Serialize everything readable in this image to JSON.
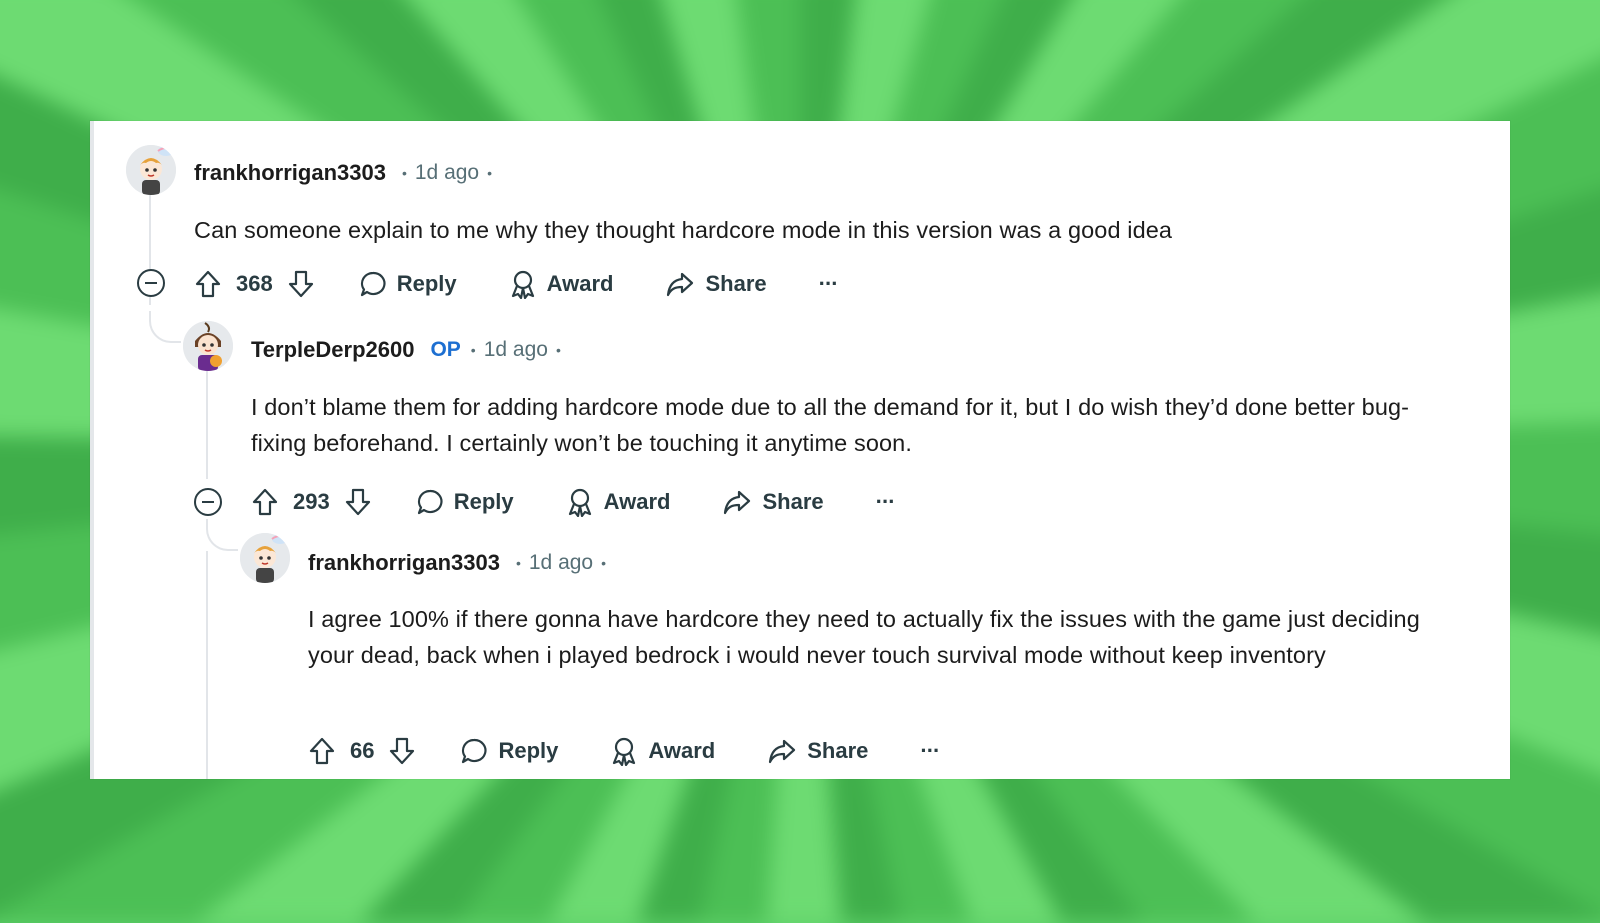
{
  "thread": {
    "comments": [
      {
        "username": "frankhorrigan3303",
        "op_badge": "",
        "time": "1d ago",
        "body": "Can someone explain to me why they thought hardcore mode in this version was a good idea",
        "score": "368",
        "reply_label": "Reply",
        "award_label": "Award",
        "share_label": "Share",
        "more_label": "···"
      },
      {
        "username": "TerpleDerp2600",
        "op_badge": "OP",
        "time": "1d ago",
        "body": "I don’t blame them for adding hardcore mode due to all the demand for it, but I do wish they’d done better bug-fixing beforehand. I certainly won’t be touching it anytime soon.",
        "score": "293",
        "reply_label": "Reply",
        "award_label": "Award",
        "share_label": "Share",
        "more_label": "···"
      },
      {
        "username": "frankhorrigan3303",
        "op_badge": "",
        "time": "1d ago",
        "body": "I agree 100% if there gonna have hardcore they need to actually fix the issues with the game just deciding your dead, back when i played bedrock i would never touch survival mode without keep inventory",
        "score": "66",
        "reply_label": "Reply",
        "award_label": "Award",
        "share_label": "Share",
        "more_label": "···"
      }
    ]
  },
  "colors": {
    "text": "#1c1c1c",
    "meta": "#576f76",
    "op": "#1d6fd1",
    "thread_line": "#e2e5e9",
    "background_green": "#5fd16a"
  }
}
